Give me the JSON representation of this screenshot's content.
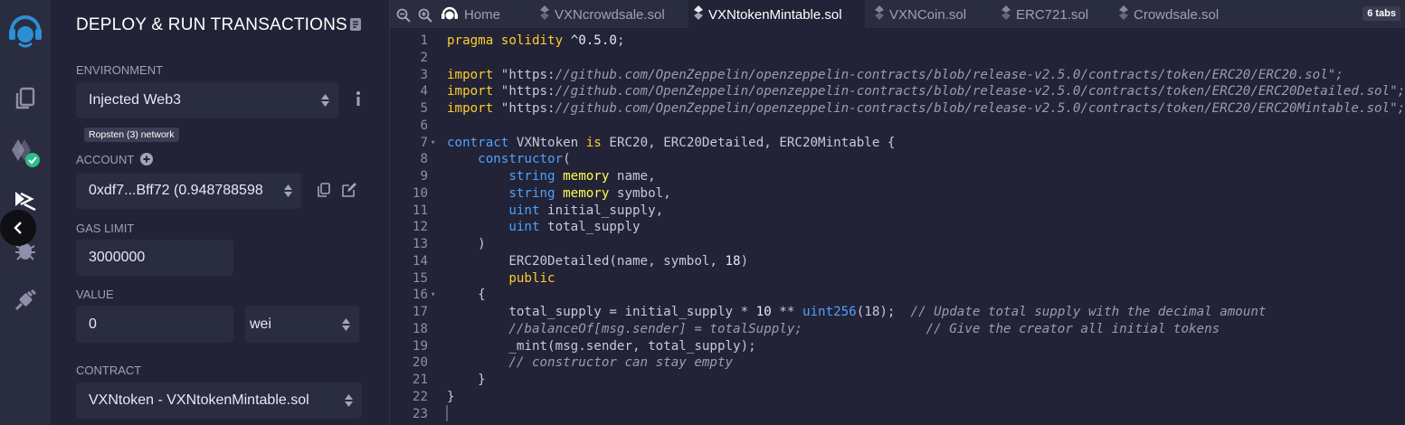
{
  "panel": {
    "title": "DEPLOY & RUN TRANSACTIONS",
    "environment_label": "ENVIRONMENT",
    "environment_value": "Injected Web3",
    "network_badge": "Ropsten (3) network",
    "account_label": "ACCOUNT",
    "account_value": "0xdf7...Bff72 (0.948788598",
    "gas_limit_label": "GAS LIMIT",
    "gas_limit_value": "3000000",
    "value_label": "VALUE",
    "value_amount": "0",
    "value_unit": "wei",
    "contract_label": "CONTRACT",
    "contract_value": "VXNtoken - VXNtokenMintable.sol"
  },
  "tabs": {
    "home_label": "Home",
    "files": [
      "VXNcrowdsale.sol",
      "VXNtokenMintable.sol",
      "VXNCoin.sol",
      "ERC721.sol",
      "Crowdsale.sol"
    ],
    "active_index": 1,
    "count_label": "6 tabs"
  },
  "code_lines": [
    "pragma solidity ^0.5.0;",
    "",
    "import \"https://github.com/OpenZeppelin/openzeppelin-contracts/blob/release-v2.5.0/contracts/token/ERC20/ERC20.sol\";",
    "import \"https://github.com/OpenZeppelin/openzeppelin-contracts/blob/release-v2.5.0/contracts/token/ERC20/ERC20Detailed.sol\";",
    "import \"https://github.com/OpenZeppelin/openzeppelin-contracts/blob/release-v2.5.0/contracts/token/ERC20/ERC20Mintable.sol\";",
    "",
    "contract VXNtoken is ERC20, ERC20Detailed, ERC20Mintable {",
    "    constructor(",
    "        string memory name,",
    "        string memory symbol,",
    "        uint initial_supply,",
    "        uint total_supply",
    "    )",
    "        ERC20Detailed(name, symbol, 18)",
    "        public",
    "    {",
    "        total_supply = initial_supply * 10 ** uint256(18);  // Update total supply with the decimal amount",
    "        //balanceOf[msg.sender] = totalSupply;                // Give the creator all initial tokens",
    "        _mint(msg.sender, total_supply);",
    "        // constructor can stay empty",
    "    }",
    "}",
    ""
  ],
  "fold_lines": [
    7,
    16
  ],
  "colors": {
    "background": "#222336",
    "rail": "#2a2c3f",
    "keyword": "#ffcd2c",
    "type": "#4fa1ff",
    "memory": "#ffff55",
    "success": "#2fbd8a"
  },
  "icons": {
    "logo": "remix-logo-icon",
    "file_explorer": "file-explorer-icon",
    "compiler": "solidity-compiler-icon",
    "deploy": "deploy-run-icon",
    "debugger": "debugger-icon",
    "plugin": "plugin-manager-icon"
  }
}
